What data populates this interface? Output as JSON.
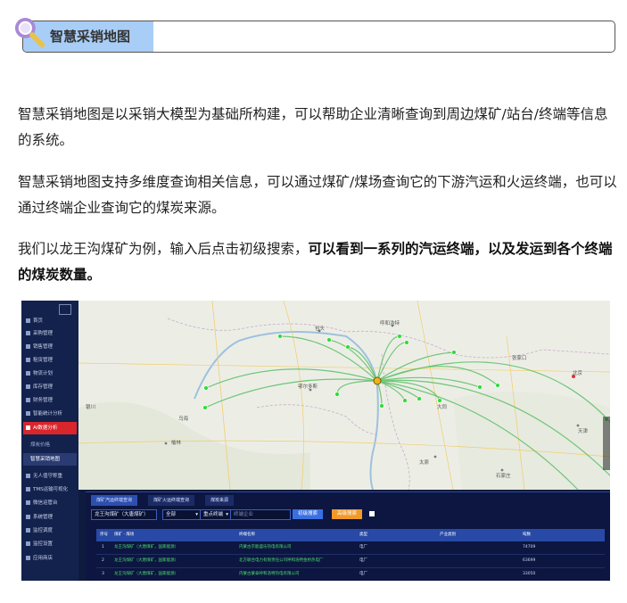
{
  "heading": {
    "title": "智慧采销地图"
  },
  "paragraphs": {
    "p1": "智慧采销地图是以采销大模型为基础所构建，可以帮助企业清晰查询到周边煤矿/站台/终端等信息的系统。",
    "p2": "智慧采销地图支持多维度查询相关信息，可以通过煤矿/煤场查询它的下游汽运和火运终端，也可以通过终端企业查询它的煤炭来源。",
    "p3_normal": "我们以龙王沟煤矿为例，输入后点击初级搜索，",
    "p3_bold": "可以看到一系列的汽运终端，以及发运到各个终端的煤炭数量。"
  },
  "screenshot": {
    "sidebar": [
      {
        "label": "首页"
      },
      {
        "label": "采购管理"
      },
      {
        "label": "销售管理"
      },
      {
        "label": "租赁管理"
      },
      {
        "label": "物流计划"
      },
      {
        "label": "库存管理"
      },
      {
        "label": "财务管理"
      },
      {
        "label": "智能统计分析"
      },
      {
        "label": "AI数据分析"
      },
      {
        "label": "煤炭价格"
      },
      {
        "label": "智慧采销地图"
      },
      {
        "label": "无人值守称重"
      },
      {
        "label": "TMS运输可视化"
      },
      {
        "label": "微信运管台"
      },
      {
        "label": "系统管理"
      },
      {
        "label": "监控调度"
      },
      {
        "label": "监控设置"
      },
      {
        "label": "应用商店"
      }
    ],
    "map_labels": {
      "hohhot": "呼和浩特",
      "baotou": "包头",
      "beijing": "北京",
      "tianjin": "天津",
      "taiyuan": "太原",
      "shijiazhuang": "石家庄",
      "ordos": "鄂尔多斯",
      "yulin": "榆林",
      "zhangjiakou": "张家口",
      "datong": "大同",
      "yinchuan": "银川",
      "wuhai": "乌海"
    },
    "tabs": [
      "煤矿汽运终端查询",
      "煤矿火运终端查询",
      "煤炭来源"
    ],
    "mine_input": "龙王沟煤矿（大唐煤矿）",
    "type_select": "全部",
    "end_select": "重点终端",
    "company_placeholder": "终端企业",
    "search_button": "初级搜索",
    "advanced_button": "高级搜索",
    "table": {
      "headers": [
        "序号",
        "煤矿 · 煤场",
        "终端名称",
        "类型",
        "产业类别",
        "吨数"
      ],
      "rows": [
        [
          "1",
          "龙王沟煤矿（大唐煤矿，国家能源）",
          "内蒙古京能盛乐热电有限公司",
          "电厂",
          "",
          "74709"
        ],
        [
          "2",
          "龙王沟煤矿（大唐煤矿，国家能源）",
          "北方联合电力有限责任公司呼和浩特金桥热电厂",
          "电厂",
          "",
          "63699"
        ],
        [
          "3",
          "龙王沟煤矿（大唐煤矿，国家能源）",
          "内蒙古蒙泰呼和浩特热电有限公司",
          "电厂",
          "",
          "33050"
        ]
      ]
    },
    "colors": {
      "route": "#5bbf66",
      "node": "#2fdd3a",
      "sidebar": "#13224d",
      "active": "#d8262c"
    }
  }
}
